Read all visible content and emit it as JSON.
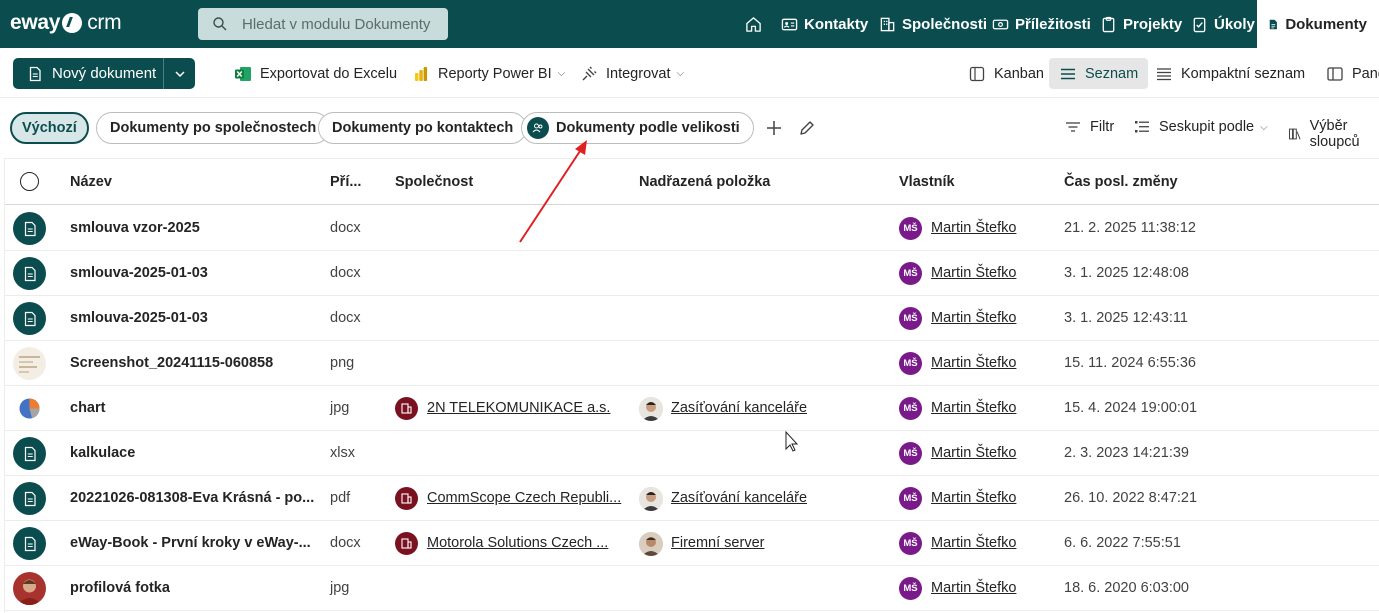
{
  "app": {
    "logo_left": "eway",
    "logo_right": "crm"
  },
  "search": {
    "placeholder": "Hledat v modulu Dokumenty"
  },
  "nav": {
    "home_icon": "home-icon",
    "items": [
      {
        "label": "Kontakty",
        "icon": "contact-card-icon"
      },
      {
        "label": "Společnosti",
        "icon": "building-icon"
      },
      {
        "label": "Příležitosti",
        "icon": "money-icon"
      },
      {
        "label": "Projekty",
        "icon": "clipboard-icon"
      },
      {
        "label": "Úkoly",
        "icon": "task-icon"
      },
      {
        "label": "Dokumenty",
        "icon": "document-icon"
      }
    ]
  },
  "toolbar": {
    "new_document": "Nový dokument",
    "export_excel": "Exportovat do Excelu",
    "powerbi": "Reporty Power BI",
    "integrate": "Integrovat",
    "kanban": "Kanban",
    "list": "Seznam",
    "compact_list": "Kompaktní seznam",
    "panel": "Panel"
  },
  "views": {
    "default": "Výchozí",
    "by_company": "Dokumenty po společnostech",
    "by_contact": "Dokumenty po kontaktech",
    "by_size": "Dokumenty podle velikosti",
    "filter": "Filtr",
    "group_by": "Seskupit podle",
    "columns": "Výběr sloupců"
  },
  "grid": {
    "headers": {
      "name": "Název",
      "ext": "Pří...",
      "company": "Společnost",
      "parent": "Nadřazená položka",
      "owner": "Vlastník",
      "modified": "Čas posl. změny"
    },
    "rows": [
      {
        "name": "smlouva vzor-2025",
        "ext": "docx",
        "company": "",
        "parent": "",
        "owner_initials": "MŠ",
        "owner": "Martin Štefko",
        "modified": "21. 2. 2025 11:38:12",
        "thumb": "document-icon"
      },
      {
        "name": "smlouva-2025-01-03",
        "ext": "docx",
        "company": "",
        "parent": "",
        "owner_initials": "MŠ",
        "owner": "Martin Štefko",
        "modified": "3. 1. 2025 12:48:08",
        "thumb": "document-icon"
      },
      {
        "name": "smlouva-2025-01-03",
        "ext": "docx",
        "company": "",
        "parent": "",
        "owner_initials": "MŠ",
        "owner": "Martin Štefko",
        "modified": "3. 1. 2025 12:43:11",
        "thumb": "document-icon"
      },
      {
        "name": "Screenshot_20241115-060858",
        "ext": "png",
        "company": "",
        "parent": "",
        "owner_initials": "MŠ",
        "owner": "Martin Štefko",
        "modified": "15. 11. 2024 6:55:36",
        "thumb": "screenshot-thumbnail"
      },
      {
        "name": "chart",
        "ext": "jpg",
        "company": "2N TELEKOMUNIKACE a.s.",
        "parent": "Zasíťování kanceláře",
        "owner_initials": "MŠ",
        "owner": "Martin Štefko",
        "modified": "15. 4. 2024 19:00:01",
        "thumb": "pie-chart-thumbnail"
      },
      {
        "name": "kalkulace",
        "ext": "xlsx",
        "company": "",
        "parent": "",
        "owner_initials": "MŠ",
        "owner": "Martin Štefko",
        "modified": "2. 3. 2023 14:21:39",
        "thumb": "document-icon"
      },
      {
        "name": "20221026-081308-Eva Krásná - po...",
        "ext": "pdf",
        "company": "CommScope Czech Republi...",
        "parent": "Zasíťování kanceláře",
        "owner_initials": "MŠ",
        "owner": "Martin Štefko",
        "modified": "26. 10. 2022 8:47:21",
        "thumb": "document-icon"
      },
      {
        "name": "eWay-Book - První kroky v eWay-...",
        "ext": "docx",
        "company": "Motorola Solutions Czech ...",
        "parent": "Firemní server",
        "owner_initials": "MŠ",
        "owner": "Martin Štefko",
        "modified": "6. 6. 2022 7:55:51",
        "thumb": "document-icon"
      },
      {
        "name": "profilová fotka",
        "ext": "jpg",
        "company": "",
        "parent": "",
        "owner_initials": "MŠ",
        "owner": "Martin Štefko",
        "modified": "18. 6. 2020 6:03:00",
        "thumb": "profile-photo-thumbnail"
      }
    ]
  },
  "colors": {
    "brand": "#0b4d4f",
    "avatar": "#7a1a8a",
    "company": "#7a1121",
    "annotation_arrow": "#e02020"
  }
}
